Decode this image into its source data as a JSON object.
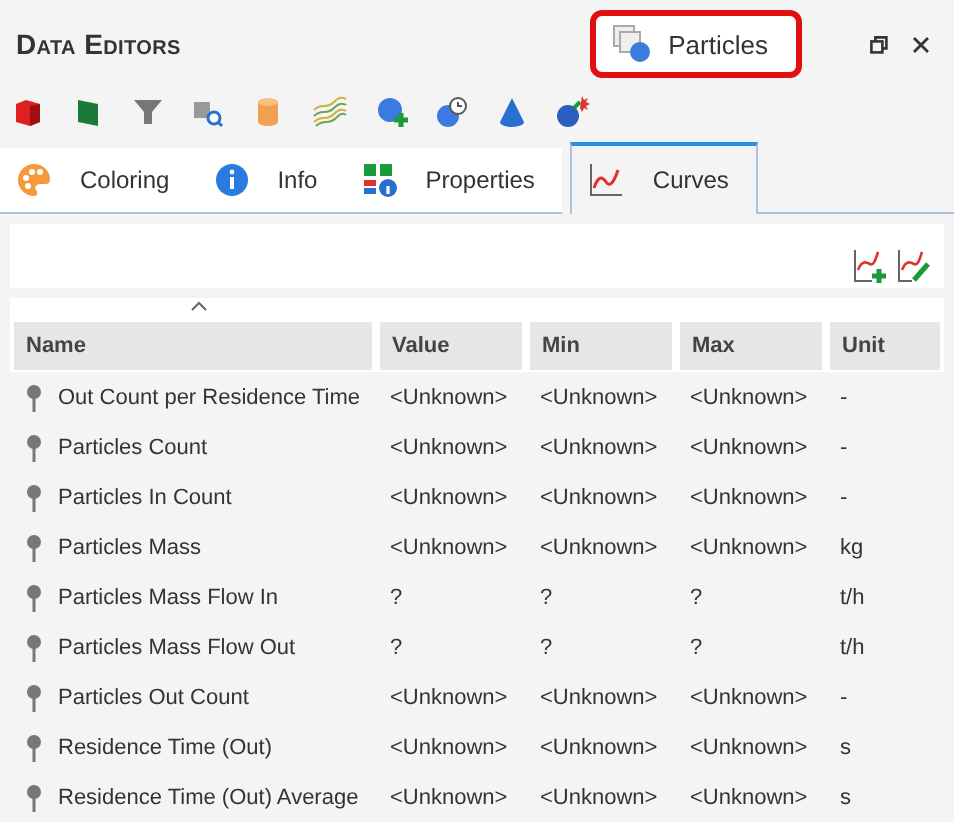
{
  "panel": {
    "title": "Data Editors",
    "selection": "Particles"
  },
  "tabs": [
    {
      "label": "Coloring",
      "kind": "palette",
      "selected": false
    },
    {
      "label": "Info",
      "kind": "info",
      "selected": false
    },
    {
      "label": "Properties",
      "kind": "properties",
      "selected": false
    },
    {
      "label": "Curves",
      "kind": "curves",
      "selected": true
    }
  ],
  "table": {
    "columns": [
      "Name",
      "Value",
      "Min",
      "Max",
      "Unit"
    ],
    "rows": [
      [
        "Out Count per Residence Time",
        "<Unknown>",
        "<Unknown>",
        "<Unknown>",
        "-"
      ],
      [
        "Particles Count",
        "<Unknown>",
        "<Unknown>",
        "<Unknown>",
        "-"
      ],
      [
        "Particles In Count",
        "<Unknown>",
        "<Unknown>",
        "<Unknown>",
        "-"
      ],
      [
        "Particles Mass",
        "<Unknown>",
        "<Unknown>",
        "<Unknown>",
        "kg"
      ],
      [
        "Particles Mass Flow In",
        "?",
        "?",
        "?",
        "t/h"
      ],
      [
        "Particles Mass Flow Out",
        "?",
        "?",
        "?",
        "t/h"
      ],
      [
        "Particles Out Count",
        "<Unknown>",
        "<Unknown>",
        "<Unknown>",
        "-"
      ],
      [
        "Residence Time (Out)",
        "<Unknown>",
        "<Unknown>",
        "<Unknown>",
        "s"
      ],
      [
        "Residence Time (Out) Average",
        "<Unknown>",
        "<Unknown>",
        "<Unknown>",
        "s"
      ]
    ]
  }
}
